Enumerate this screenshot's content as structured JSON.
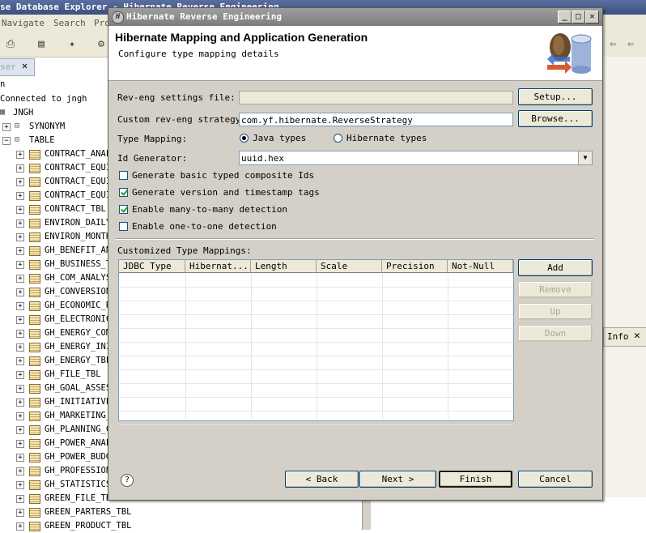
{
  "background": {
    "window_title": "se Database Explorer - Hibernate Reverse Engineering",
    "menu": [
      "Navigate",
      "Search",
      "Pro"
    ],
    "tab_label": "ser",
    "connection": "Connected to jngh",
    "schema": "JNGH",
    "node_synonym": "SYNONYM",
    "node_table": "TABLE",
    "tables": [
      "CONTRACT_ANAL",
      "CONTRACT_EQUI",
      "CONTRACT_EQUI",
      "CONTRACT_EQUI",
      "CONTRACT_TBL",
      "ENVIRON_DAILY",
      "ENVIRON_MONTH",
      "GH_BENEFIT_AN",
      "GH_BUSINESS_T",
      "GH_COM_ANALYS",
      "GH_CONVERSION",
      "GH_ECONOMIC_R",
      "GH_ELECTRONIC",
      "GH_ENERGY_COM",
      "GH_ENERGY_INI",
      "GH_ENERGY_TBL",
      "GH_FILE_TBL",
      "GH_GOAL_ASSES",
      "GH_INITIATIVE",
      "GH_MARKETING_",
      "GH_PLANNING_C",
      "GH_POWER_ANAL",
      "GH_POWER_BUDG",
      "GH_PROFESSION",
      "GH_STATISTICS",
      "GREEN_FILE_TBL",
      "GREEN_PARTERS_TBL",
      "GREEN_PRODUCT_TBL"
    ],
    "info_tab": "Info"
  },
  "dialog": {
    "title": "Hibernate Reverse Engineering",
    "banner_title": "Hibernate Mapping and Application Generation",
    "banner_subtitle": "Configure type mapping details",
    "rev_eng_label": "Rev-eng settings file:",
    "rev_eng_value": "",
    "setup_button": "Setup...",
    "strategy_label": "Custom rev-eng strategy:",
    "strategy_value": "com.yf.hibernate.ReverseStrategy",
    "browse_button": "Browse...",
    "type_mapping_label": "Type Mapping:",
    "radio_java": "Java types",
    "radio_hibernate": "Hibernate types",
    "id_generator_label": "Id Generator:",
    "id_generator_value": "uuid.hex",
    "checkboxes": [
      {
        "label": "Generate basic typed composite Ids",
        "checked": false
      },
      {
        "label": "Generate version and timestamp tags",
        "checked": true
      },
      {
        "label": "Enable many-to-many detection",
        "checked": true
      },
      {
        "label": "Enable one-to-one detection",
        "checked": false
      }
    ],
    "custom_mappings_label": "Customized Type Mappings:",
    "columns": [
      "JDBC Type",
      "Hibernat...",
      "Length",
      "Scale",
      "Precision",
      "Not-Null"
    ],
    "add_button": "Add",
    "remove_button": "Remove",
    "up_button": "Up",
    "down_button": "Down",
    "back_button": "< Back",
    "next_button": "Next >",
    "finish_button": "Finish",
    "cancel_button": "Cancel",
    "help_icon": "?"
  }
}
